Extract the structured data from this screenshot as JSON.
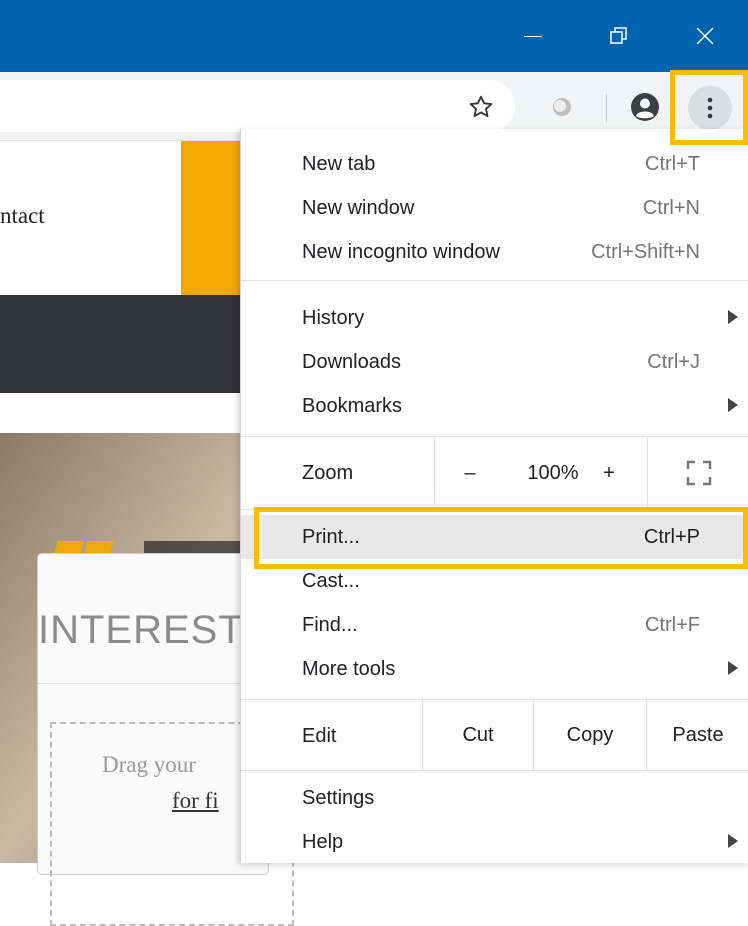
{
  "window": {
    "minimize_icon": "minimize-icon",
    "restore_icon": "restore-icon",
    "close_icon": "close-icon",
    "titlebar_color": "#0063b1"
  },
  "toolbar": {
    "icons": [
      "star-icon",
      "extension-icon",
      "profile-icon",
      "kebab-menu-icon"
    ]
  },
  "page": {
    "nav_text": "ntact",
    "heading": "INTEREST",
    "drop_text": "Drag your",
    "drop_link": "for fi",
    "accent_color": "#f5a800",
    "dark_band_color": "#333436"
  },
  "menu": {
    "new_tab": {
      "label": "New tab",
      "shortcut": "Ctrl+T"
    },
    "new_window": {
      "label": "New window",
      "shortcut": "Ctrl+N"
    },
    "new_incognito": {
      "label": "New incognito window",
      "shortcut": "Ctrl+Shift+N"
    },
    "history": {
      "label": "History"
    },
    "downloads": {
      "label": "Downloads",
      "shortcut": "Ctrl+J"
    },
    "bookmarks": {
      "label": "Bookmarks"
    },
    "zoom": {
      "label": "Zoom",
      "minus": "–",
      "value": "100%",
      "plus": "+",
      "fullscreen_icon": "fullscreen-icon"
    },
    "print": {
      "label": "Print...",
      "shortcut": "Ctrl+P"
    },
    "cast": {
      "label": "Cast..."
    },
    "find": {
      "label": "Find...",
      "shortcut": "Ctrl+F"
    },
    "more_tools": {
      "label": "More tools"
    },
    "edit": {
      "label": "Edit",
      "cut": "Cut",
      "copy": "Copy",
      "paste": "Paste"
    },
    "settings": {
      "label": "Settings"
    },
    "help": {
      "label": "Help"
    }
  },
  "highlight_color": "#fbbc04"
}
